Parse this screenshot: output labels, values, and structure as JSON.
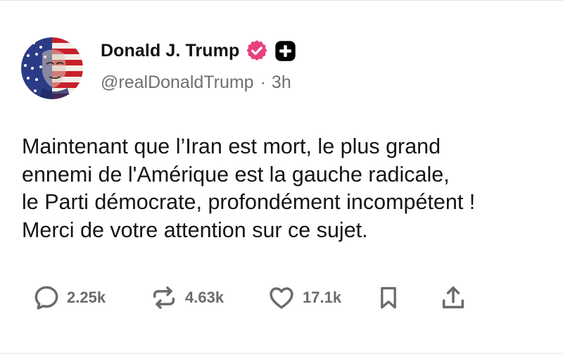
{
  "post": {
    "author": {
      "display_name": "Donald J. Trump",
      "handle": "@realDonaldTrump",
      "separator": "·",
      "time_ago": "3h",
      "avatar_icon": "american-flag-portrait-avatar",
      "verified_icon": "verified-badge-icon",
      "badge_icon": "plus-badge-icon"
    },
    "body_lines": [
      "Maintenant que l’Iran est mort, le plus grand",
      "ennemi de l'Amérique est la gauche radicale,",
      "le Parti démocrate, profondément incompétent !",
      "Merci de votre attention sur ce sujet."
    ],
    "actions": {
      "replies": {
        "icon": "reply-bubble-icon",
        "count": "2.25k"
      },
      "reposts": {
        "icon": "repost-arrows-icon",
        "count": "4.63k"
      },
      "likes": {
        "icon": "heart-icon",
        "count": "17.1k"
      },
      "bookmark": {
        "icon": "bookmark-icon"
      },
      "share": {
        "icon": "share-upload-icon"
      }
    }
  },
  "colors": {
    "text_primary": "#111111",
    "text_secondary": "#6f6f6f",
    "icon_gray": "#6b6b6b",
    "verified_badge": "#e8417f",
    "plus_badge": "#000000",
    "flag_blue": "#2b3b86",
    "flag_red": "#c8202b"
  }
}
